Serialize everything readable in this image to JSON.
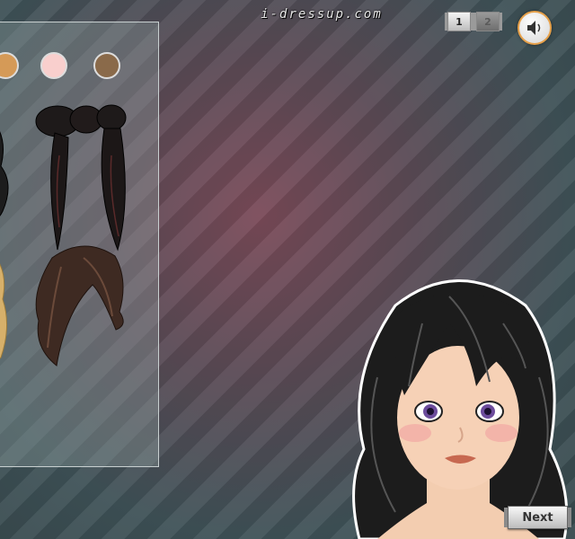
{
  "brand": "i-dressup.com",
  "pages": [
    {
      "label": "1",
      "active": true
    },
    {
      "label": "2",
      "active": false
    }
  ],
  "sound_icon": "speaker-icon",
  "skin_swatches": [
    "#d59a57",
    "#f9cfcd",
    "#8a6a4a"
  ],
  "hair_options": [
    "curly-black-hair",
    "pigtail-buns-dark-hair",
    "blonde-curly-hair",
    "brown-wavy-hair"
  ],
  "next_label": "Next",
  "colors": {
    "accent": "#e7a14a",
    "hair": "#1c1c1c",
    "skin": "#f6d1b6",
    "eyes": "#6c4c9c"
  }
}
